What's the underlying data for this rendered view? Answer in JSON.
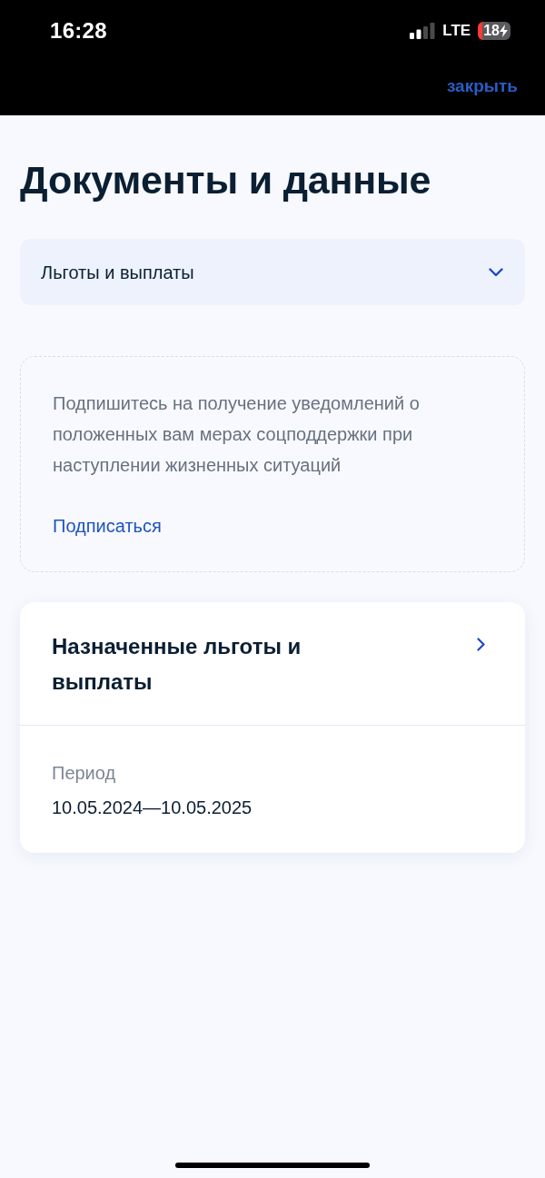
{
  "status_bar": {
    "time": "16:28",
    "network": "LTE",
    "battery": "18"
  },
  "header": {
    "close_link": "закрыть"
  },
  "title": "Документы и данные",
  "category_select": {
    "value": "Льготы и выплаты",
    "expanded": false
  },
  "subscribe_notice": {
    "text": "Подпишитесь на получение уведомлений о положенных вам мерах соцподдержки при наступлении жизненных ситуаций",
    "link": "Подписаться"
  },
  "benefits_card": {
    "title": "Назначенные льготы и выплаты",
    "fields": [
      {
        "label": "Период",
        "value": "10.05.2024—10.05.2025"
      }
    ]
  }
}
